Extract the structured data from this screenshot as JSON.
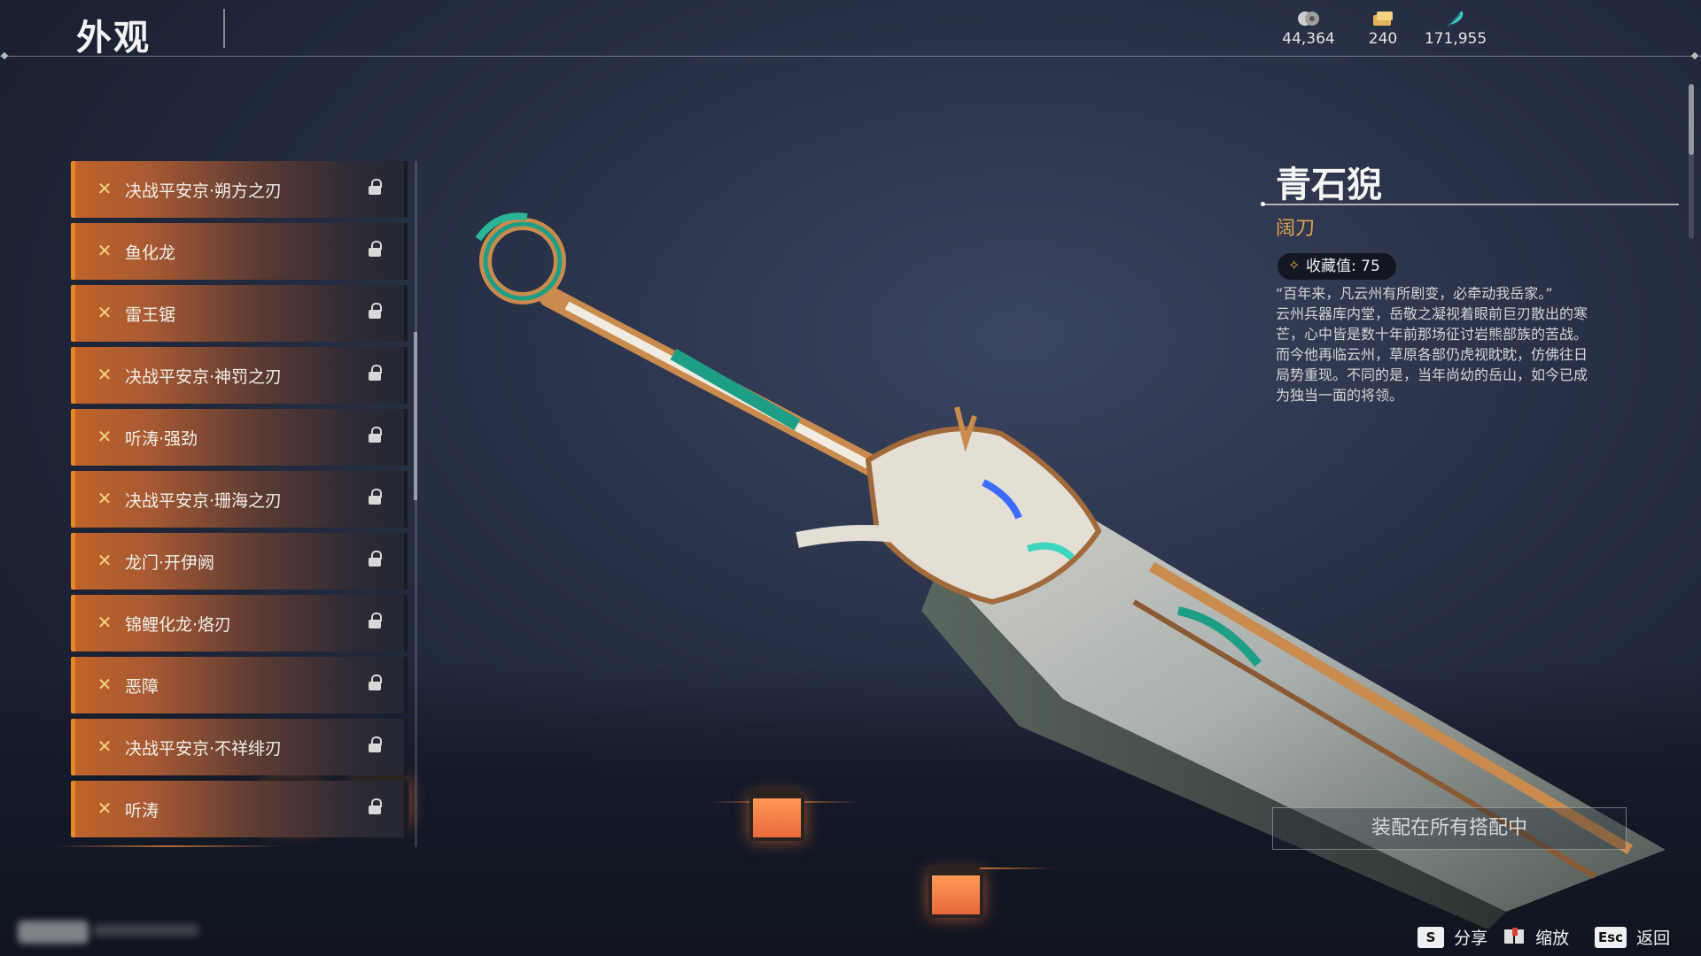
{
  "header": {
    "title": "外观",
    "currencies": [
      {
        "icon": "coin-icon",
        "value": "44,364"
      },
      {
        "icon": "ticket-icon",
        "value": "240"
      },
      {
        "icon": "feather-icon",
        "value": "171,955"
      }
    ]
  },
  "list": {
    "items": [
      {
        "label": "决战平安京·朔方之刃"
      },
      {
        "label": "鱼化龙"
      },
      {
        "label": "雷王锯"
      },
      {
        "label": "决战平安京·神罚之刃"
      },
      {
        "label": "听涛·强劲"
      },
      {
        "label": "决战平安京·珊海之刃"
      },
      {
        "label": "龙门·开伊阙"
      },
      {
        "label": "锦鲤化龙·烙刃"
      },
      {
        "label": "恶障"
      },
      {
        "label": "决战平安京·不祥绯刃"
      },
      {
        "label": "听涛"
      }
    ]
  },
  "detail": {
    "name": "青石猊",
    "type": "阔刀",
    "collect_value": "收藏值: 75",
    "description": [
      "“百年来，凡云州有所剧变，必牵动我岳家。”",
      "云州兵器库内堂，岳敬之凝视着眼前巨刃散出的寒",
      "芒，心中皆是数十年前那场征讨岩熊部族的苦战。",
      "而今他再临云州，草原各部仍虎视眈眈，仿佛往日",
      "局势重现。不同的是，当年尚幼的岳山，如今已成",
      "为独当一面的将领。"
    ]
  },
  "equip_button": "装配在所有搭配中",
  "hints": {
    "share": {
      "key": "S",
      "label": "分享"
    },
    "zoom": {
      "label": "缩放"
    },
    "back": {
      "key": "Esc",
      "label": "返回"
    }
  },
  "colors": {
    "accent_orange": "#e5882a",
    "type_gold": "#e0a24e",
    "bg_navy": "#1c2335"
  }
}
